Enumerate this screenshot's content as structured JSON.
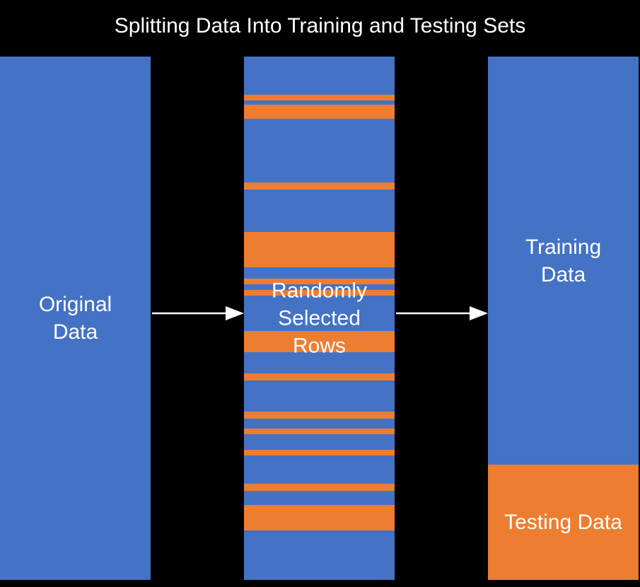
{
  "title": "Splitting Data Into Training and Testing Sets",
  "columns": {
    "original": {
      "label": "Original\nData"
    },
    "random": {
      "label": "Randomly\nSelected\nRows"
    },
    "split": {
      "train_label": "Training\nData",
      "test_label": "Testing Data"
    }
  },
  "colors": {
    "blue": "#4472c4",
    "orange": "#ed7d31"
  },
  "chart_data": {
    "type": "diagram",
    "description": "Train/test split visualization showing original data randomly split into training (~78%) and testing (~22%) sets",
    "stripes": [
      {
        "color": "blue",
        "flex": 54
      },
      {
        "color": "orange",
        "flex": 8
      },
      {
        "color": "blue",
        "flex": 6
      },
      {
        "color": "orange",
        "flex": 20
      },
      {
        "color": "blue",
        "flex": 90
      },
      {
        "color": "orange",
        "flex": 10
      },
      {
        "color": "blue",
        "flex": 60
      },
      {
        "color": "orange",
        "flex": 50
      },
      {
        "color": "blue",
        "flex": 16
      },
      {
        "color": "orange",
        "flex": 8
      },
      {
        "color": "blue",
        "flex": 8
      },
      {
        "color": "orange",
        "flex": 8
      },
      {
        "color": "blue",
        "flex": 50
      },
      {
        "color": "orange",
        "flex": 30
      },
      {
        "color": "blue",
        "flex": 30
      },
      {
        "color": "orange",
        "flex": 10
      },
      {
        "color": "blue",
        "flex": 44
      },
      {
        "color": "orange",
        "flex": 10
      },
      {
        "color": "blue",
        "flex": 14
      },
      {
        "color": "orange",
        "flex": 8
      },
      {
        "color": "blue",
        "flex": 22
      },
      {
        "color": "orange",
        "flex": 8
      },
      {
        "color": "blue",
        "flex": 40
      },
      {
        "color": "orange",
        "flex": 10
      },
      {
        "color": "blue",
        "flex": 20
      },
      {
        "color": "orange",
        "flex": 36
      },
      {
        "color": "blue",
        "flex": 30
      }
    ],
    "train_fraction": 0.78,
    "test_fraction": 0.22
  }
}
